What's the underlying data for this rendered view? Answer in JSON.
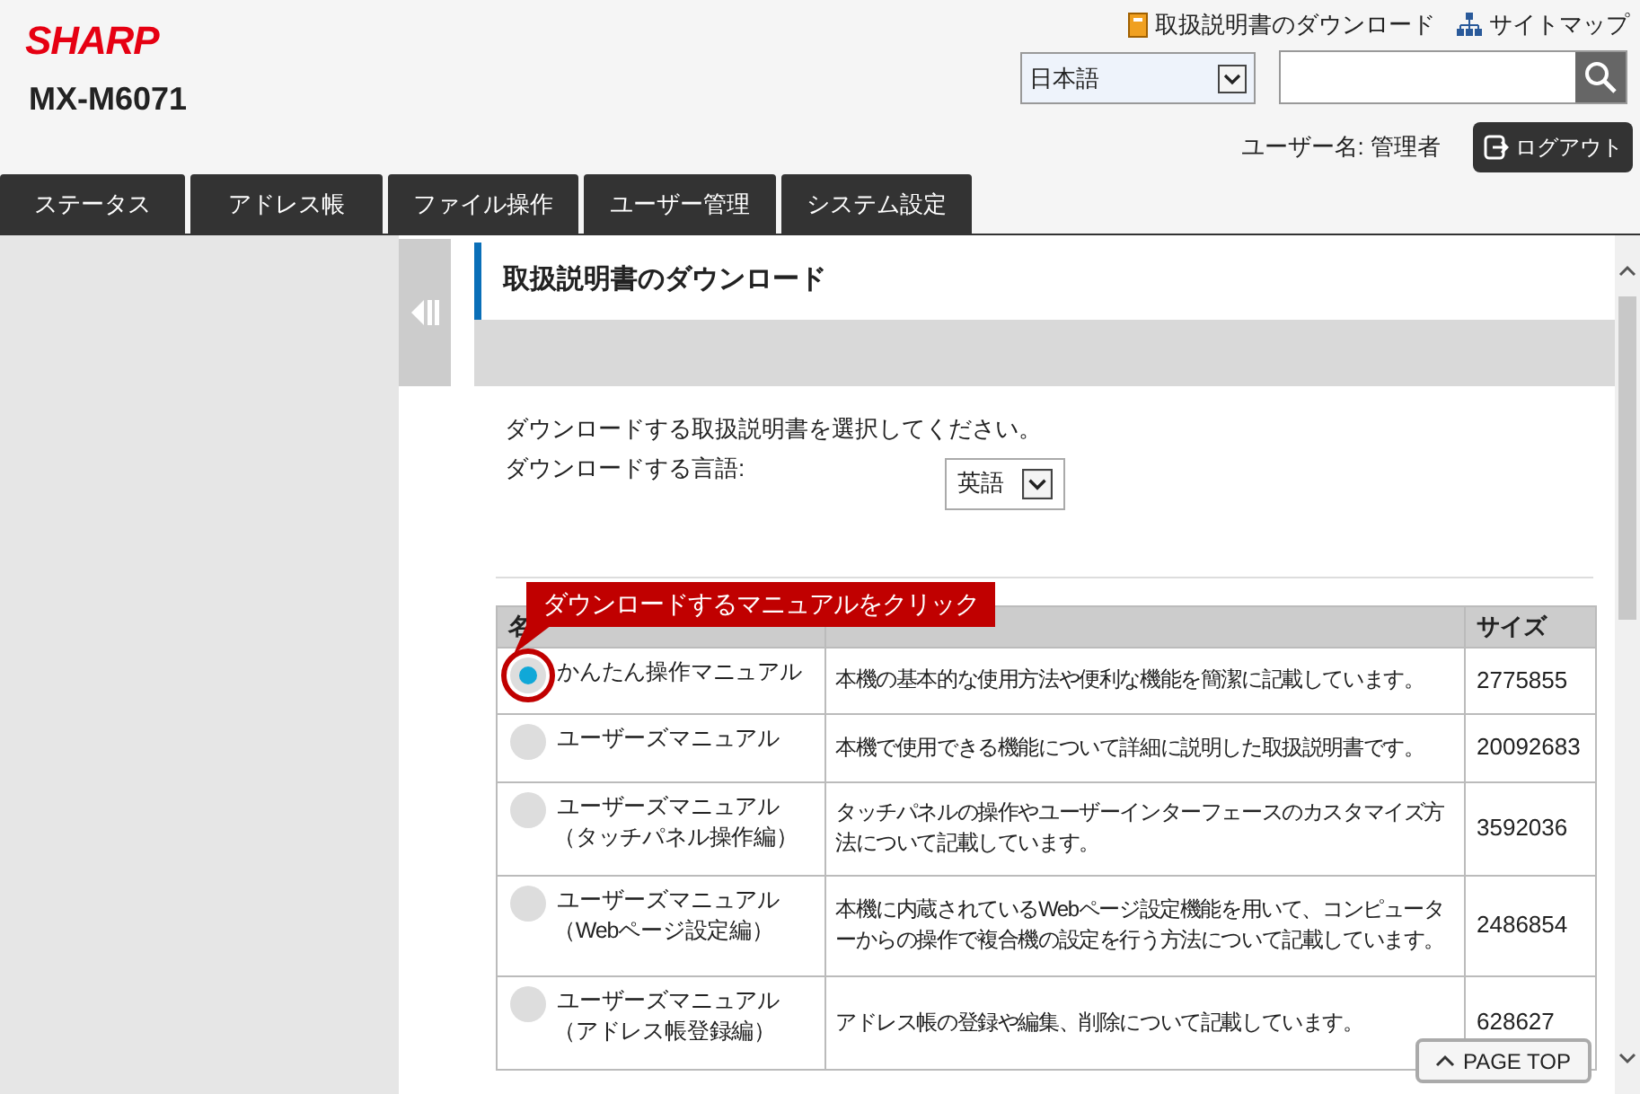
{
  "header": {
    "logo": "SHARP",
    "model": "MX-M6071",
    "links": [
      {
        "kind": "book",
        "label": "取扱説明書のダウンロード"
      },
      {
        "kind": "sitemap",
        "label": "サイトマップ"
      }
    ],
    "language": "日本語",
    "user_label": "ユーザー名: 管理者",
    "logout": "ログアウト"
  },
  "tabs": [
    {
      "label": "ステータス",
      "selected": false
    },
    {
      "label": "アドレス帳",
      "selected": false
    },
    {
      "label": "ファイル操作",
      "selected": false
    },
    {
      "label": "ユーザー管理",
      "selected": false
    },
    {
      "label": "システム設定",
      "selected": false
    }
  ],
  "panel": {
    "title": "取扱説明書のダウンロード",
    "instruction": "ダウンロードする取扱説明書を選択してください。",
    "language_label": "ダウンロードする言語:",
    "language": "英語"
  },
  "callout": "ダウンロードするマニュアルをクリック",
  "table": {
    "columns": [
      "名",
      "サイズ"
    ],
    "rows": [
      {
        "selected": true,
        "name": [
          "かんたん操作マニュアル"
        ],
        "description": "本機の基本的な使用方法や便利な機能を簡潔に記載しています。",
        "size": "2775855"
      },
      {
        "selected": false,
        "name": [
          "ユーザーズマニュアル"
        ],
        "description": "本機で使用できる機能について詳細に説明した取扱説明書です。",
        "size": "20092683"
      },
      {
        "selected": false,
        "name": [
          "ユーザーズマニュアル",
          "（タッチパネル操作編）"
        ],
        "description": "タッチパネルの操作やユーザーインターフェースのカスタマイズ方法について記載しています。",
        "size": "3592036"
      },
      {
        "selected": false,
        "name": [
          "ユーザーズマニュアル",
          "（Webページ設定編）"
        ],
        "description": "本機に内蔵されているWebページ設定機能を用いて、コンピューターからの操作で複合機の設定を行う方法について記載しています。",
        "size": "2486854"
      },
      {
        "selected": false,
        "name": [
          "ユーザーズマニュアル",
          "（アドレス帳登録編）"
        ],
        "description": "アドレス帳の登録や編集、削除について記載しています。",
        "size": "628627"
      }
    ]
  },
  "page_top": "PAGE TOP"
}
